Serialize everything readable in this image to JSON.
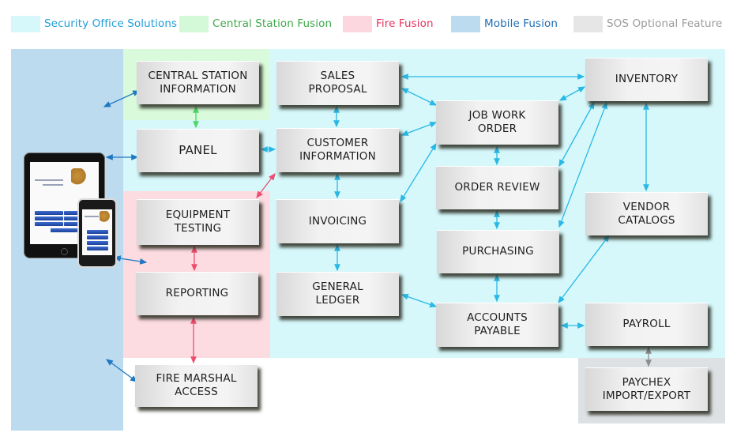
{
  "legend": [
    {
      "label": "Security Office Solutions",
      "swatch": "#d6f8fb",
      "text_color": "#1f9ed8"
    },
    {
      "label": "Central Station Fusion",
      "swatch": "#d3f9d8",
      "text_color": "#3fa94a"
    },
    {
      "label": "Fire Fusion",
      "swatch": "#fcd7df",
      "text_color": "#e8335f"
    },
    {
      "label": "Mobile Fusion",
      "swatch": "#bcdbef",
      "text_color": "#1d6db5"
    },
    {
      "label": "SOS Optional Feature",
      "swatch": "#e6e6e6",
      "text_color": "#9b9b9b"
    }
  ],
  "regions": {
    "mobile": "#bcdbef",
    "sos": "#d6f8fb",
    "central": "#d9fbdb",
    "fire": "#fcdbe1",
    "optional": "#dde1e3"
  },
  "boxes": {
    "central_station_information": "CENTRAL STATION\nINFORMATION",
    "panel": "PANEL",
    "equipment_testing": "EQUIPMENT\nTESTING",
    "reporting": "REPORTING",
    "fire_marshal_access": "FIRE MARSHAL\nACCESS",
    "sales_proposal": "SALES\nPROPOSAL",
    "customer_information": "CUSTOMER\nINFORMATION",
    "invoicing": "INVOICING",
    "general_ledger": "GENERAL\nLEDGER",
    "job_work_order": "JOB WORK\nORDER",
    "order_review": "ORDER REVIEW",
    "purchasing": "PURCHASING",
    "accounts_payable": "ACCOUNTS\nPAYABLE",
    "inventory": "INVENTORY",
    "vendor_catalogs": "VENDOR\nCATALOGS",
    "payroll": "PAYROLL",
    "paychex_import_export": "PAYCHEX\nIMPORT/EXPORT"
  },
  "connector_colors": {
    "sos": "#29b8e5",
    "mobile": "#1f78c1",
    "central": "#4cd964",
    "fire": "#ee4d6f",
    "optional": "#8c8c8c"
  },
  "connections": [
    {
      "from": "mobile_region",
      "to": "central_station_information",
      "type": "mobile"
    },
    {
      "from": "tablet",
      "to": "panel",
      "type": "mobile"
    },
    {
      "from": "phone",
      "to": "fire_region",
      "type": "mobile"
    },
    {
      "from": "mobile_region",
      "to": "fire_marshal_access",
      "type": "mobile"
    },
    {
      "from": "central_station_information",
      "to": "panel",
      "type": "central"
    },
    {
      "from": "panel",
      "to": "customer_information",
      "type": "sos"
    },
    {
      "from": "customer_information",
      "to": "equipment_testing",
      "type": "fire"
    },
    {
      "from": "equipment_testing",
      "to": "reporting",
      "type": "fire"
    },
    {
      "from": "reporting",
      "to": "fire_marshal_access",
      "type": "fire"
    },
    {
      "from": "sales_proposal",
      "to": "customer_information",
      "type": "sos"
    },
    {
      "from": "sales_proposal",
      "to": "inventory",
      "type": "sos"
    },
    {
      "from": "sales_proposal",
      "to": "job_work_order",
      "type": "sos"
    },
    {
      "from": "customer_information",
      "to": "job_work_order",
      "type": "sos"
    },
    {
      "from": "customer_information",
      "to": "invoicing",
      "type": "sos"
    },
    {
      "from": "invoicing",
      "to": "job_work_order",
      "type": "sos"
    },
    {
      "from": "invoicing",
      "to": "general_ledger",
      "type": "sos"
    },
    {
      "from": "general_ledger",
      "to": "accounts_payable",
      "type": "sos"
    },
    {
      "from": "job_work_order",
      "to": "order_review",
      "type": "sos"
    },
    {
      "from": "job_work_order",
      "to": "inventory",
      "type": "sos"
    },
    {
      "from": "order_review",
      "to": "purchasing",
      "type": "sos"
    },
    {
      "from": "order_review",
      "to": "inventory",
      "type": "sos"
    },
    {
      "from": "purchasing",
      "to": "inventory",
      "type": "sos"
    },
    {
      "from": "purchasing",
      "to": "accounts_payable",
      "type": "sos"
    },
    {
      "from": "inventory",
      "to": "vendor_catalogs",
      "type": "sos"
    },
    {
      "from": "vendor_catalogs",
      "to": "accounts_payable",
      "type": "sos"
    },
    {
      "from": "accounts_payable",
      "to": "payroll",
      "type": "sos"
    },
    {
      "from": "payroll",
      "to": "paychex_import_export",
      "type": "optional"
    }
  ]
}
